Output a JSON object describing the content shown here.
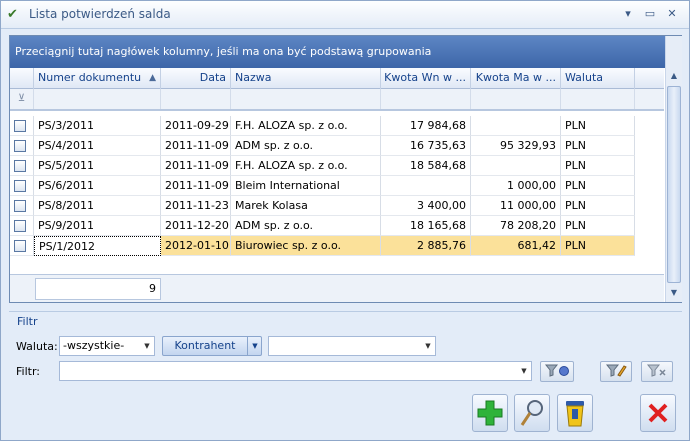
{
  "window": {
    "title": "Lista potwierdzeń salda",
    "icon": "checkmark-app-icon"
  },
  "grid": {
    "group_panel": "Przeciągnij tutaj nagłówek kolumny, jeśli ma ona być podstawą grupowania",
    "columns": [
      "Numer dokumentu",
      "Data",
      "Nazwa",
      "Kwota Wn w ...",
      "Kwota Ma w ...",
      "Waluta"
    ],
    "sort_indicator": "▲",
    "rows": [
      {
        "numer": "PS/3/2011",
        "data": "2011-09-29",
        "nazwa": "F.H. ALOZA sp. z o.o.",
        "wn": "17 984,68",
        "ma": "",
        "waluta": "PLN"
      },
      {
        "numer": "PS/4/2011",
        "data": "2011-11-09",
        "nazwa": "ADM sp. z o.o.",
        "wn": "16 735,63",
        "ma": "95 329,93",
        "waluta": "PLN"
      },
      {
        "numer": "PS/5/2011",
        "data": "2011-11-09",
        "nazwa": "F.H. ALOZA sp. z o.o.",
        "wn": "18 584,68",
        "ma": "",
        "waluta": "PLN"
      },
      {
        "numer": "PS/6/2011",
        "data": "2011-11-09",
        "nazwa": "Bleim International",
        "wn": "",
        "ma": "1 000,00",
        "waluta": "PLN"
      },
      {
        "numer": "PS/8/2011",
        "data": "2011-11-23",
        "nazwa": "Marek Kolasa",
        "wn": "3 400,00",
        "ma": "11 000,00",
        "waluta": "PLN"
      },
      {
        "numer": "PS/9/2011",
        "data": "2011-12-20",
        "nazwa": "ADM sp. z o.o.",
        "wn": "18 165,68",
        "ma": "78 208,20",
        "waluta": "PLN"
      },
      {
        "numer": "PS/1/2012",
        "data": "2012-01-10",
        "nazwa": "Biurowiec sp. z o.o.",
        "wn": "2 885,76",
        "ma": "681,42",
        "waluta": "PLN"
      }
    ],
    "footer_count": "9"
  },
  "filter": {
    "legend": "Filtr",
    "waluta_label": "Waluta:",
    "waluta_value": "-wszystkie-",
    "kontrahent_label": "Kontrahent",
    "kontrahent_value": "",
    "filtr_label": "Filtr:",
    "filtr_value": ""
  },
  "colors": {
    "accent": "#3d66a8",
    "selected_row": "#fbe19a"
  }
}
